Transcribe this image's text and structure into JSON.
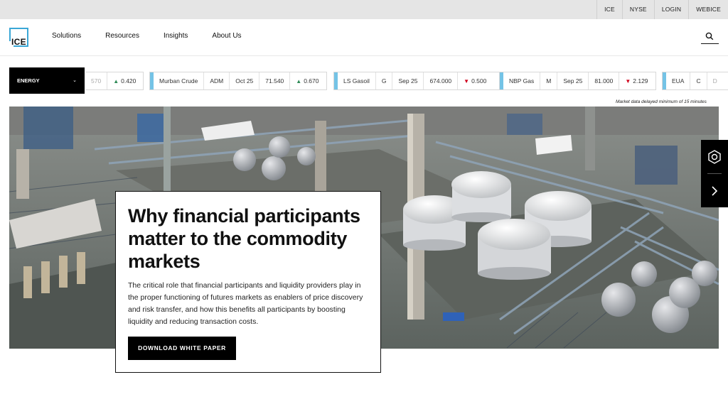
{
  "utility_links": [
    "ICE",
    "NYSE",
    "LOGIN",
    "WEBICE"
  ],
  "logo_text": "ICE",
  "nav": {
    "items": [
      "Solutions",
      "Resources",
      "Insights",
      "About Us"
    ]
  },
  "ticker": {
    "category": "ENERGY",
    "cards": [
      {
        "fields": [
          "570",
          "0.420"
        ],
        "direction": "up"
      },
      {
        "fields": [
          "Murban Crude",
          "ADM",
          "Oct 25",
          "71.540",
          "0.670"
        ],
        "direction": "up"
      },
      {
        "fields": [
          "LS Gasoil",
          "G",
          "Sep 25",
          "674.000",
          "0.500"
        ],
        "direction": "down"
      },
      {
        "fields": [
          "NBP Gas",
          "M",
          "Sep 25",
          "81.000",
          "2.129"
        ],
        "direction": "down"
      },
      {
        "fields": [
          "EUA",
          "C",
          "D"
        ],
        "direction": "none"
      }
    ],
    "delay_note": "Market data delayed minimum of 15 minutes"
  },
  "hero": {
    "headline": "Why financial participants matter to the commodity markets",
    "body": "The critical role that financial participants and liquidity providers play in the proper functioning of futures markets as enablers of price discovery and risk transfer, and how this benefits all participants by boosting liquidity and reducing transaction costs.",
    "cta_label": "DOWNLOAD WHITE PAPER"
  },
  "colors": {
    "accent_blue": "#74c3e6",
    "logo_blue": "#3aa7d6",
    "up_green": "#2e8b57",
    "down_red": "#d0021b"
  }
}
